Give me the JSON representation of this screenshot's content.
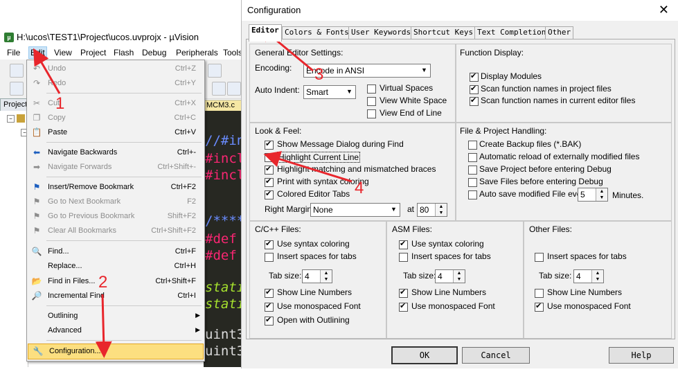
{
  "uvision": {
    "title": "H:\\ucos\\TEST1\\Project\\ucos.uvprojx - µVision",
    "menu": [
      "File",
      "Edit",
      "View",
      "Project",
      "Flash",
      "Debug",
      "Peripherals",
      "Tools"
    ],
    "project_tab": "Project",
    "editor_tab": "MCM3.c",
    "code_lines": [
      "//#in",
      "#incl",
      "#incl",
      "/****",
      "#def",
      "#def",
      "stati",
      "stati",
      "uint3",
      "uint3"
    ]
  },
  "edit_menu": {
    "items": [
      {
        "label": "Undo",
        "shortcut": "Ctrl+Z",
        "icon": "undo-icon"
      },
      {
        "label": "Redo",
        "shortcut": "Ctrl+Y",
        "icon": "redo-icon"
      },
      {
        "label": "Cut",
        "shortcut": "Ctrl+X",
        "icon": "cut-icon"
      },
      {
        "label": "Copy",
        "shortcut": "Ctrl+C",
        "icon": "copy-icon"
      },
      {
        "label": "Paste",
        "shortcut": "Ctrl+V",
        "icon": "paste-icon"
      },
      {
        "label": "Navigate Backwards",
        "shortcut": "Ctrl+-",
        "icon": "arrow-left-icon"
      },
      {
        "label": "Navigate Forwards",
        "shortcut": "Ctrl+Shift+-",
        "icon": "arrow-right-icon"
      },
      {
        "label": "Insert/Remove Bookmark",
        "shortcut": "Ctrl+F2",
        "icon": "bookmark-icon"
      },
      {
        "label": "Go to Next Bookmark",
        "shortcut": "F2",
        "icon": "bookmark-next-icon"
      },
      {
        "label": "Go to Previous Bookmark",
        "shortcut": "Shift+F2",
        "icon": "bookmark-prev-icon"
      },
      {
        "label": "Clear All Bookmarks",
        "shortcut": "Ctrl+Shift+F2",
        "icon": "bookmark-clear-icon"
      },
      {
        "label": "Find...",
        "shortcut": "Ctrl+F",
        "icon": "find-icon"
      },
      {
        "label": "Replace...",
        "shortcut": "Ctrl+H",
        "icon": ""
      },
      {
        "label": "Find in Files...",
        "shortcut": "Ctrl+Shift+F",
        "icon": "find-in-files-icon"
      },
      {
        "label": "Incremental Find",
        "shortcut": "Ctrl+I",
        "icon": "incremental-find-icon"
      },
      {
        "label": "Outlining",
        "shortcut": "",
        "icon": ""
      },
      {
        "label": "Advanced",
        "shortcut": "",
        "icon": ""
      },
      {
        "label": "Configuration...",
        "shortcut": "",
        "icon": "wrench-icon"
      }
    ]
  },
  "config": {
    "title": "Configuration",
    "close": "✕",
    "tabs": [
      "Editor",
      "Colors & Fonts",
      "User Keywords",
      "Shortcut Keys",
      "Text Completion",
      "Other"
    ],
    "general": {
      "title": "General Editor Settings:",
      "encoding_label": "Encoding:",
      "encoding_value": "Encode in ANSI",
      "auto_indent_label": "Auto Indent:",
      "auto_indent_value": "Smart",
      "virtual_spaces": "Virtual Spaces",
      "view_white_space": "View White Space",
      "view_end_of_line": "View End of Line"
    },
    "function_display": {
      "title": "Function Display:",
      "items": [
        "Display Modules",
        "Scan function names in project files",
        "Scan function names in current editor files"
      ]
    },
    "look_feel": {
      "title": "Look & Feel:",
      "items": [
        "Show Message Dialog during Find",
        "Highlight Current Line",
        "Highlight matching and mismatched braces",
        "Print with syntax coloring",
        "Colored Editor Tabs"
      ],
      "right_margin_label": "Right Margin:",
      "right_margin_value": "None",
      "at_label": "at",
      "at_value": "80"
    },
    "file_project": {
      "title": "File & Project Handling:",
      "items": [
        "Create Backup files (*.BAK)",
        "Automatic reload of externally modified files",
        "Save Project before entering Debug",
        "Save Files before entering Debug",
        "Auto save modified File every"
      ],
      "minutes_value": "5",
      "minutes_label": "Minutes."
    },
    "cpp": {
      "title": "C/C++ Files:",
      "items": [
        "Use syntax coloring",
        "Insert spaces for tabs",
        "Show Line Numbers",
        "Use monospaced Font",
        "Open with Outlining"
      ],
      "tab_size_label": "Tab size:",
      "tab_size": "4"
    },
    "asm": {
      "title": "ASM Files:",
      "items": [
        "Use syntax coloring",
        "Insert spaces for tabs",
        "Show Line Numbers",
        "Use monospaced Font"
      ],
      "tab_size_label": "Tab size:",
      "tab_size": "4"
    },
    "other": {
      "title": "Other Files:",
      "items": [
        "Insert spaces for tabs",
        "Show Line Numbers",
        "Use monospaced Font"
      ],
      "tab_size_label": "Tab size:",
      "tab_size": "4"
    },
    "buttons": {
      "ok": "OK",
      "cancel": "Cancel",
      "help": "Help"
    }
  },
  "annotations": [
    "1",
    "2",
    "3",
    "4"
  ],
  "colors": {
    "annotation": "#e8262c",
    "menu_highlight": "#fcdf80",
    "editor_bg": "#272822"
  }
}
